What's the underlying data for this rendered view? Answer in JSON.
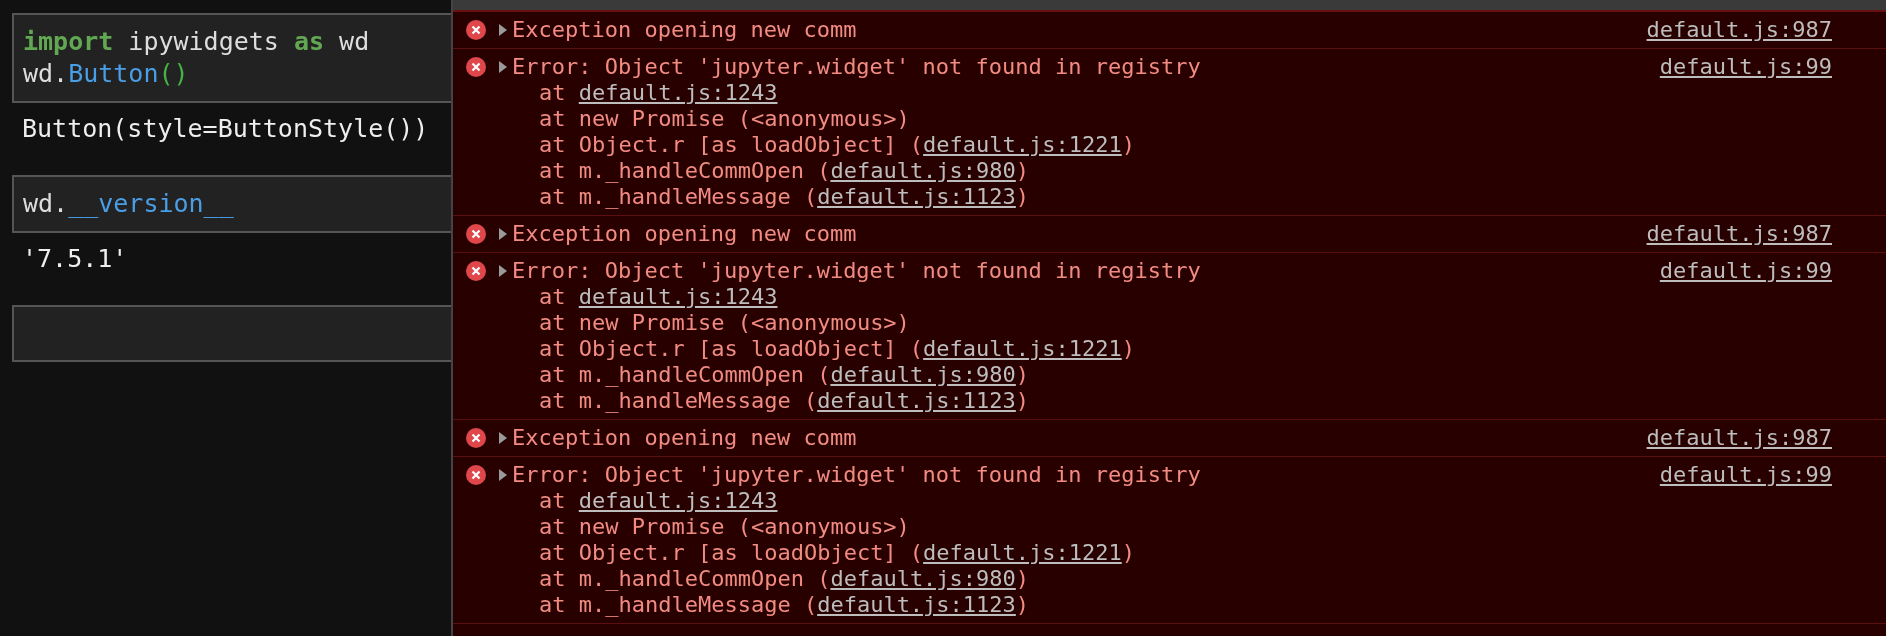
{
  "notebook": {
    "cells": [
      {
        "kind": "input",
        "tokens": [
          {
            "kind": "keyword",
            "text": "import"
          },
          {
            "kind": "plain",
            "text": " ipywidgets "
          },
          {
            "kind": "keyword",
            "text": "as"
          },
          {
            "kind": "plain",
            "text": " wd\nwd."
          },
          {
            "kind": "name",
            "text": "Button"
          },
          {
            "kind": "paren",
            "text": "()"
          }
        ]
      },
      {
        "kind": "output",
        "text": "Button(style=ButtonStyle())"
      },
      {
        "kind": "input",
        "tokens": [
          {
            "kind": "plain",
            "text": "wd."
          },
          {
            "kind": "name",
            "text": "__version__"
          }
        ]
      },
      {
        "kind": "output",
        "text": "'7.5.1'"
      },
      {
        "kind": "input"
      }
    ]
  },
  "console": {
    "messages": [
      {
        "summary": "Exception opening new comm",
        "source": "default.js:987"
      },
      {
        "summary": "Error: Object 'jupyter.widget' not found in registry",
        "source": "default.js:99",
        "stack": [
          {
            "before": "at ",
            "link": "default.js:1243"
          },
          {
            "before": "at new Promise (<anonymous>)"
          },
          {
            "before": "at Object.r [as loadObject] (",
            "link": "default.js:1221",
            "after": ")"
          },
          {
            "before": "at m._handleCommOpen (",
            "link": "default.js:980",
            "after": ")"
          },
          {
            "before": "at m._handleMessage (",
            "link": "default.js:1123",
            "after": ")"
          }
        ]
      },
      {
        "summary": "Exception opening new comm",
        "source": "default.js:987"
      },
      {
        "summary": "Error: Object 'jupyter.widget' not found in registry",
        "source": "default.js:99",
        "stack": [
          {
            "before": "at ",
            "link": "default.js:1243"
          },
          {
            "before": "at new Promise (<anonymous>)"
          },
          {
            "before": "at Object.r [as loadObject] (",
            "link": "default.js:1221",
            "after": ")"
          },
          {
            "before": "at m._handleCommOpen (",
            "link": "default.js:980",
            "after": ")"
          },
          {
            "before": "at m._handleMessage (",
            "link": "default.js:1123",
            "after": ")"
          }
        ]
      },
      {
        "summary": "Exception opening new comm",
        "source": "default.js:987"
      },
      {
        "summary": "Error: Object 'jupyter.widget' not found in registry",
        "source": "default.js:99",
        "stack": [
          {
            "before": "at ",
            "link": "default.js:1243"
          },
          {
            "before": "at new Promise (<anonymous>)"
          },
          {
            "before": "at Object.r [as loadObject] (",
            "link": "default.js:1221",
            "after": ")"
          },
          {
            "before": "at m._handleCommOpen (",
            "link": "default.js:980",
            "after": ")"
          },
          {
            "before": "at m._handleMessage (",
            "link": "default.js:1123",
            "after": ")"
          }
        ]
      }
    ]
  }
}
